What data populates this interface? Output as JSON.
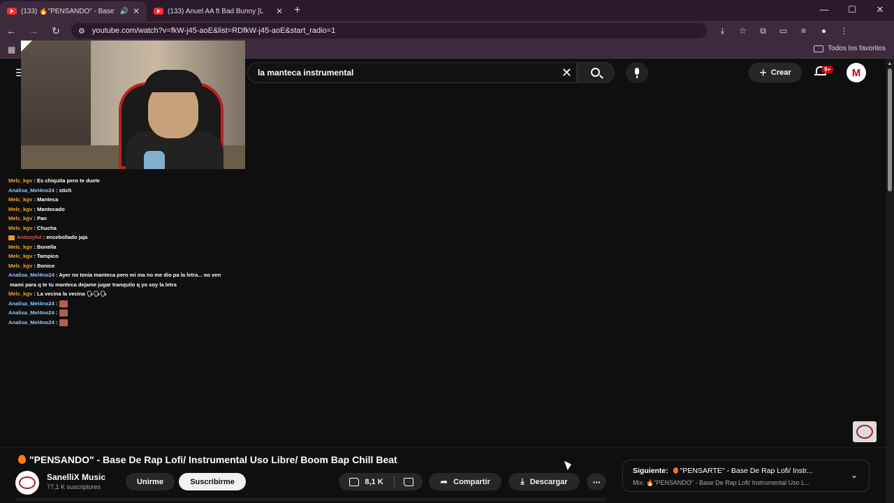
{
  "browser": {
    "tabs": [
      {
        "title": "(133) 🔥\"PENSANDO\" - Base",
        "active": true
      },
      {
        "title": "(133) Anuel AA ft Bad Bunny [L",
        "active": false
      }
    ],
    "url": "youtube.com/watch?v=fkW-j45-aoE&list=RDfkW-j45-aoE&start_radio=1",
    "bookmarks_all": "Todos los favoritos",
    "window_controls": [
      "minimize",
      "maximize",
      "close"
    ]
  },
  "youtube": {
    "search": {
      "value": "la manteca instrumental"
    },
    "create_label": "Crear",
    "notifications_badge": "9+",
    "avatar_letter": "M"
  },
  "chat": [
    {
      "user": "Melc_kgv",
      "color": "orange",
      "text": ": Es chiquita pero te duele"
    },
    {
      "user": "Analisa_Mel4no24",
      "color": "blue",
      "text": ": stich"
    },
    {
      "user": "Melc_kgv",
      "color": "orange",
      "text": ": Manteca"
    },
    {
      "user": "Melc_kgv",
      "color": "orange",
      "text": ": Mantecado"
    },
    {
      "user": "Melc_kgv",
      "color": "orange",
      "text": ": Pan"
    },
    {
      "user": "Melc_kgv",
      "color": "orange",
      "text": ": Chucha"
    },
    {
      "user": "Antonyful",
      "color": "red",
      "text": ": encebollado jaja"
    },
    {
      "user": "Melc_kgv",
      "color": "orange",
      "text": ": Bonella"
    },
    {
      "user": "Melc_kgv",
      "color": "orange",
      "text": ": Tampico"
    },
    {
      "user": "Melc_kgv",
      "color": "orange",
      "text": ": Bonice"
    },
    {
      "user": "Analisa_Mel4no24",
      "color": "blue",
      "text": ": Ayer no tenia manteca pero mi ma no me dio pa la letra... oo ven",
      "continuation": "mami para q te tu manteca dejame jugar tranquilo q yo soy la letra"
    },
    {
      "user": "Melc_kgv",
      "color": "orange",
      "text": ": La vecina la vecina 🗣🗣🗣"
    },
    {
      "user": "Analisa_Mel4no24",
      "color": "blue",
      "text": ":"
    },
    {
      "user": "Analisa_Mel4no24",
      "color": "blue",
      "text": ":"
    },
    {
      "user": "Analisa_Mel4no24",
      "color": "blue",
      "text": ":"
    }
  ],
  "video": {
    "title": "\"PENSANDO\" - Base De Rap Lofi/ Instrumental Uso Libre/ Boom Bap Chill Beat",
    "channel": "SanelliX Music",
    "subscribers": "77,1 K suscriptores",
    "join_label": "Unirme",
    "subscribe_label": "Suscribirme",
    "likes": "8,1 K",
    "share_label": "Compartir",
    "download_label": "Descargar"
  },
  "up_next": {
    "label": "Siguiente:",
    "title": "\"PENSARTE\" - Base De Rap Lofi/ Instr...",
    "mix": "Mix: 🔥\"PENSANDO\" - Base De Rap Lofi/ Instrumental Uso L..."
  },
  "colors": {
    "chrome_bg": "#3d2a3c",
    "tabbar_bg": "#2b1a2b",
    "yt_bg": "#0f0f0f",
    "chat_orange": "#f5a623",
    "chat_blue": "#8fc7ff",
    "chat_red": "#e0524f"
  }
}
